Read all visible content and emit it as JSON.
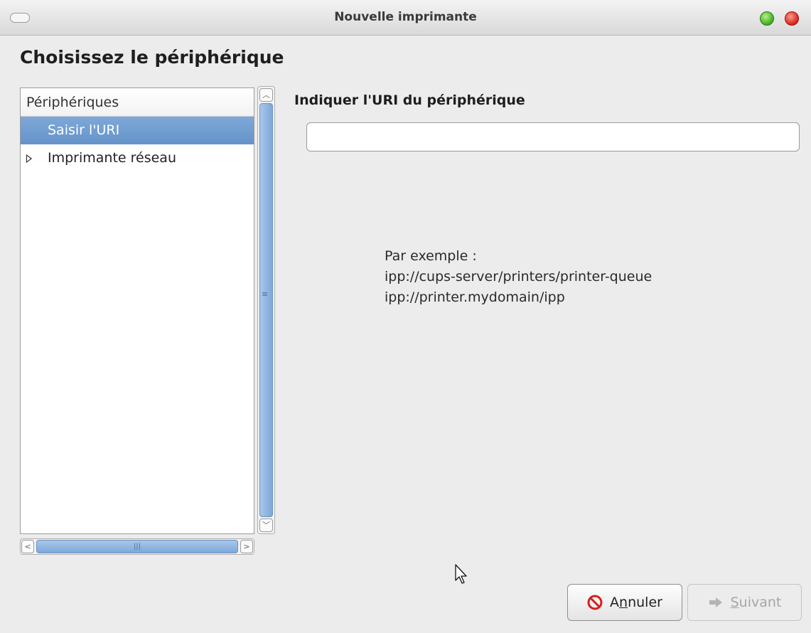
{
  "window": {
    "title": "Nouvelle imprimante"
  },
  "page": {
    "heading": "Choisissez le périphérique"
  },
  "device_list": {
    "header": "Périphériques",
    "items": [
      {
        "label": "Saisir l'URI",
        "selected": true
      },
      {
        "label": "Imprimante réseau",
        "expandable": true
      }
    ]
  },
  "uri_panel": {
    "label": "Indiquer l'URI du périphérique",
    "input_value": "",
    "example_lines": [
      "Par exemple :",
      "ipp://cups-server/printers/printer-queue",
      "ipp://printer.mydomain/ipp"
    ]
  },
  "buttons": {
    "cancel": {
      "mnemonic_prefix": "A",
      "mnemonic": "n",
      "rest": "nuler",
      "icon": "cancel-icon"
    },
    "next": {
      "mnemonic_prefix": "",
      "mnemonic": "S",
      "rest": "uivant",
      "icon": "arrow-right-icon",
      "enabled": false
    }
  },
  "colors": {
    "selection": "#6f9bd0",
    "cancel_icon": "#d4201b"
  }
}
